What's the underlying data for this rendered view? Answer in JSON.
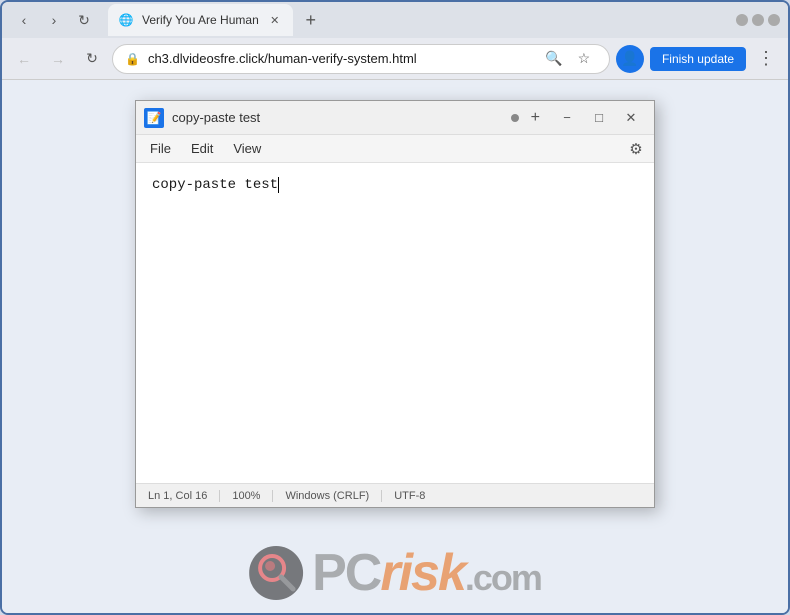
{
  "browser": {
    "tab": {
      "title": "Verify You Are Human",
      "favicon": "📄"
    },
    "url": "ch3.dlvideosfre.click/human-verify-system.html",
    "finish_update_label": "Finish update",
    "nav": {
      "back_label": "←",
      "forward_label": "→",
      "refresh_label": "↻"
    }
  },
  "notepad": {
    "title": "copy-paste test",
    "content": "copy-paste test",
    "menu": {
      "file": "File",
      "edit": "Edit",
      "view": "View"
    },
    "statusbar": {
      "position": "Ln 1, Col 16",
      "zoom": "100%",
      "line_ending": "Windows (CRLF)",
      "encoding": "UTF-8"
    }
  },
  "pcrisk": {
    "text": "PC",
    "risk": "risk",
    "dotcom": ".com"
  }
}
